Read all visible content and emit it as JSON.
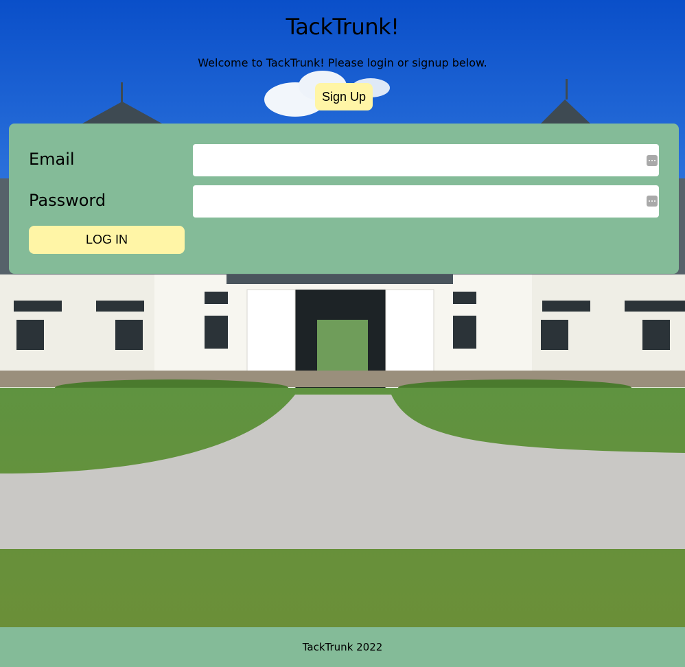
{
  "header": {
    "title": "TackTrunk!",
    "welcome": "Welcome to TackTrunk! Please login or signup below.",
    "signup_label": "Sign Up"
  },
  "login_form": {
    "email_label": "Email",
    "email_value": "",
    "password_label": "Password",
    "password_value": "",
    "login_label": "LOG IN",
    "autofill_icon": "password-manager-icon"
  },
  "footer": {
    "text": "TackTrunk 2022"
  },
  "colors": {
    "panel": "#84bb98",
    "button": "#fff5a6",
    "sky": "#1a5fd0"
  }
}
